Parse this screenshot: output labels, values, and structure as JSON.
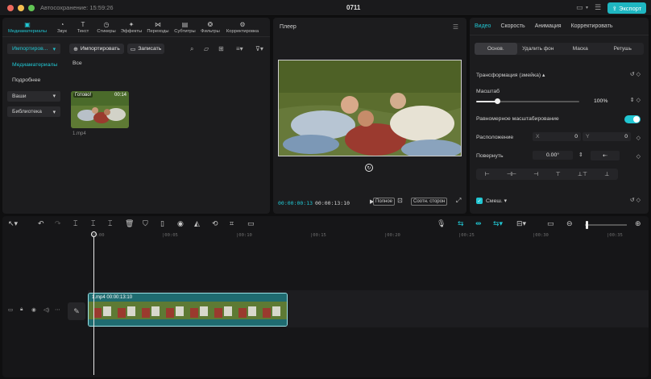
{
  "titlebar": {
    "autosave": "Автосохранение: 15:59:26",
    "project_title": "0711",
    "export_label": "Экспорт"
  },
  "media": {
    "tabs": [
      {
        "label": "Медиаматериалы",
        "icon": "media-icon"
      },
      {
        "label": "Звук",
        "icon": "audio-icon"
      },
      {
        "label": "Текст",
        "icon": "text-icon"
      },
      {
        "label": "Стикеры",
        "icon": "sticker-icon"
      },
      {
        "label": "Эффекты",
        "icon": "effects-icon"
      },
      {
        "label": "Переходы",
        "icon": "transitions-icon"
      },
      {
        "label": "Субтитры",
        "icon": "subtitles-icon"
      },
      {
        "label": "Фильтры",
        "icon": "filters-icon"
      },
      {
        "label": "Корректировка",
        "icon": "adjust-icon"
      }
    ],
    "sidebar": [
      {
        "label": "Импортиров...",
        "chevron": true
      },
      {
        "label": "Медиаматериалы",
        "chevron": false
      },
      {
        "label": "Подробнее",
        "chevron": false
      },
      {
        "label": "Ваши",
        "chevron": true
      },
      {
        "label": "Библиотека",
        "chevron": true
      }
    ],
    "import_label": "Импортировать",
    "record_label": "Записать",
    "all_label": "Все",
    "clip": {
      "status": "Готово!",
      "duration": "00:14",
      "name": "1.mp4"
    }
  },
  "player": {
    "title": "Плеер",
    "current_time": "00:00:00:13",
    "total_time": "00:00:13:10",
    "full_label": "Полное",
    "ratio_label": "Соотн. сторон"
  },
  "inspector": {
    "tabs": [
      "Видео",
      "Скорость",
      "Анимация",
      "Корректировать"
    ],
    "sub_tabs": [
      "Основ.",
      "Удалить фон",
      "Маска",
      "Ретушь"
    ],
    "transform_label": "Трансформация (змейка)",
    "scale_label": "Масштаб",
    "scale_value": "100%",
    "scale_fraction": 0.2,
    "uniform_label": "Равномерное масштабирование",
    "position_label": "Расположение",
    "pos_x_label": "X",
    "pos_x_value": "0",
    "pos_y_label": "Y",
    "pos_y_value": "0",
    "rotate_label": "Повернуть",
    "rotate_value": "0.00°",
    "blend_label": "Смеш."
  },
  "timeline": {
    "ruler": [
      "00:00",
      "|00:05",
      "|00:10",
      "|00:15",
      "|00:20",
      "|00:25",
      "|00:30",
      "|00:35"
    ],
    "clip_name": "1.mp4",
    "clip_duration": "00:00:13:10"
  }
}
